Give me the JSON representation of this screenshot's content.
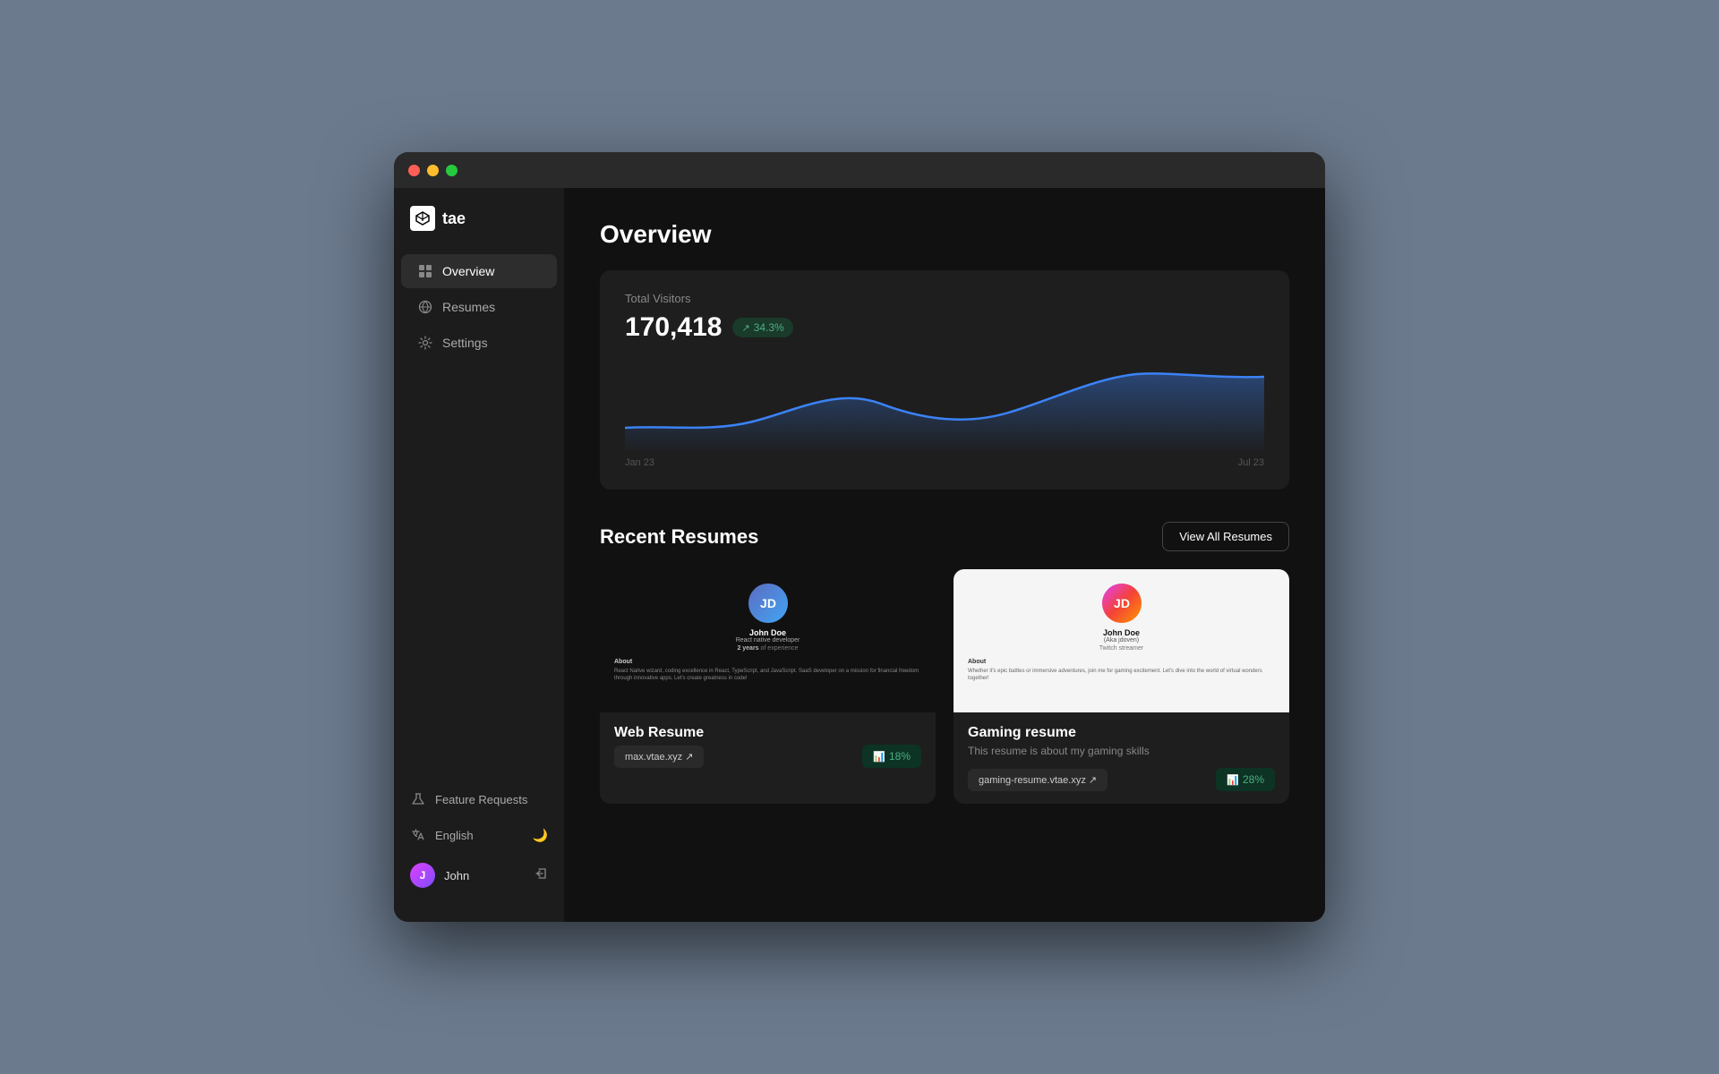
{
  "window": {
    "dots": [
      "red",
      "yellow",
      "green"
    ]
  },
  "sidebar": {
    "logo_text": "tae",
    "nav_items": [
      {
        "id": "overview",
        "label": "Overview",
        "active": true
      },
      {
        "id": "resumes",
        "label": "Resumes",
        "active": false
      },
      {
        "id": "settings",
        "label": "Settings",
        "active": false
      }
    ],
    "bottom_items": [
      {
        "id": "feature-requests",
        "label": "Feature Requests"
      },
      {
        "id": "language",
        "label": "English"
      }
    ],
    "user": {
      "name": "John",
      "initials": "J"
    }
  },
  "main": {
    "page_title": "Overview",
    "visitors_card": {
      "label": "Total Visitors",
      "count": "170,418",
      "badge": "34.3%",
      "date_start": "Jan 23",
      "date_end": "Jul 23"
    },
    "recent_resumes": {
      "title": "Recent Resumes",
      "view_all_label": "View All Resumes",
      "resumes": [
        {
          "id": "web-resume",
          "title": "Web Resume",
          "description": "",
          "link": "max.vtae.xyz ↗",
          "stat": "18%",
          "preview_name": "John Doe",
          "preview_role": "React native developer",
          "preview_exp": "2 years of experience",
          "preview_about_label": "About",
          "preview_about": "React Native wizard, coding excellence in React, TypeScript, and JavaScript. SaaS developer on a mission for financial freedom through innovative apps. Let's create greatness in code!",
          "theme": "dark"
        },
        {
          "id": "gaming-resume",
          "title": "Gaming resume",
          "description": "This resume is about my gaming skills",
          "link": "gaming-resume.vtae.xyz ↗",
          "stat": "28%",
          "preview_name": "John Doe",
          "preview_aka": "(Aka jdoven)",
          "preview_role": "Twitch streamer",
          "preview_about_label": "About",
          "preview_about": "Whether it's epic battles or immersive adventures, join me for gaming excitement. Let's dive into the world of virtual wonders together!",
          "theme": "light"
        }
      ]
    }
  }
}
